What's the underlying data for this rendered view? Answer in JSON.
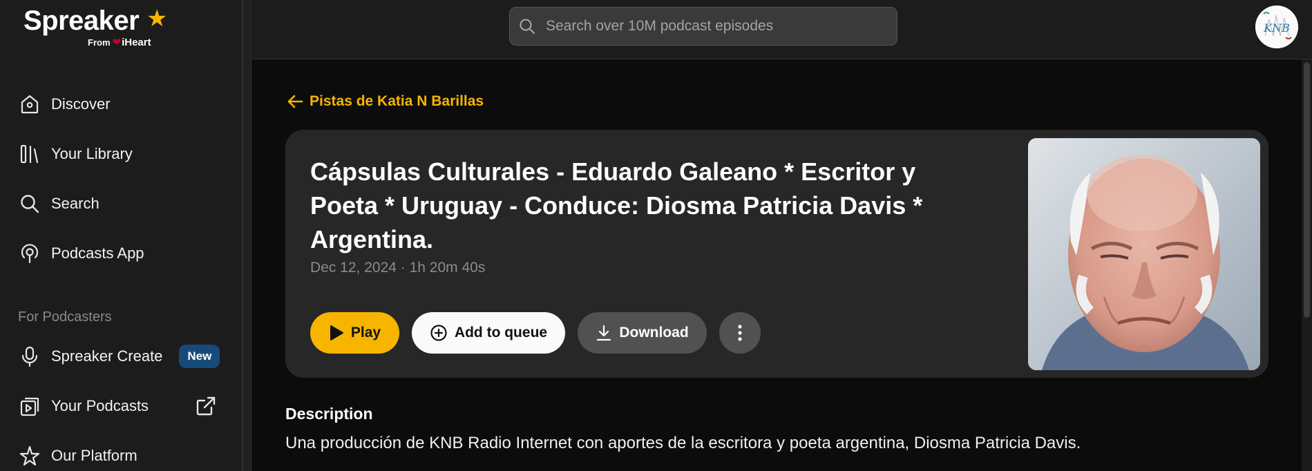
{
  "brand": {
    "name": "Spreaker",
    "from_label": "From",
    "parent_brand": "iHeart",
    "accent_color": "#f7b500"
  },
  "sidebar": {
    "items": [
      {
        "label": "Discover",
        "icon": "home-icon"
      },
      {
        "label": "Your Library",
        "icon": "library-icon"
      },
      {
        "label": "Search",
        "icon": "search-icon"
      },
      {
        "label": "Podcasts App",
        "icon": "podcast-app-icon"
      }
    ],
    "podcasters_heading": "For Podcasters",
    "podcaster_items": [
      {
        "label": "Spreaker Create",
        "icon": "microphone-icon",
        "badge": "New"
      },
      {
        "label": "Your Podcasts",
        "icon": "play-library-icon",
        "trailing_icon": "external-link-icon"
      },
      {
        "label": "Our Platform",
        "icon": "star-outline-icon"
      }
    ]
  },
  "topbar": {
    "search_placeholder": "Search over 10M podcast episodes",
    "avatar_initials": "KNB"
  },
  "main": {
    "back_link": "Pistas de Katia N Barillas",
    "episode": {
      "title": "Cápsulas Culturales - Eduardo Galeano * Escritor y Poeta * Uruguay - Conduce: Diosma Patricia Davis * Argentina.",
      "meta": "Dec 12, 2024 · 1h 20m 40s"
    },
    "actions": {
      "play": "Play",
      "queue": "Add to queue",
      "download": "Download"
    },
    "description": {
      "heading": "Description",
      "text": "Una producción de KNB Radio Internet con aportes de la escritora y poeta argentina, Diosma Patricia Davis."
    }
  }
}
